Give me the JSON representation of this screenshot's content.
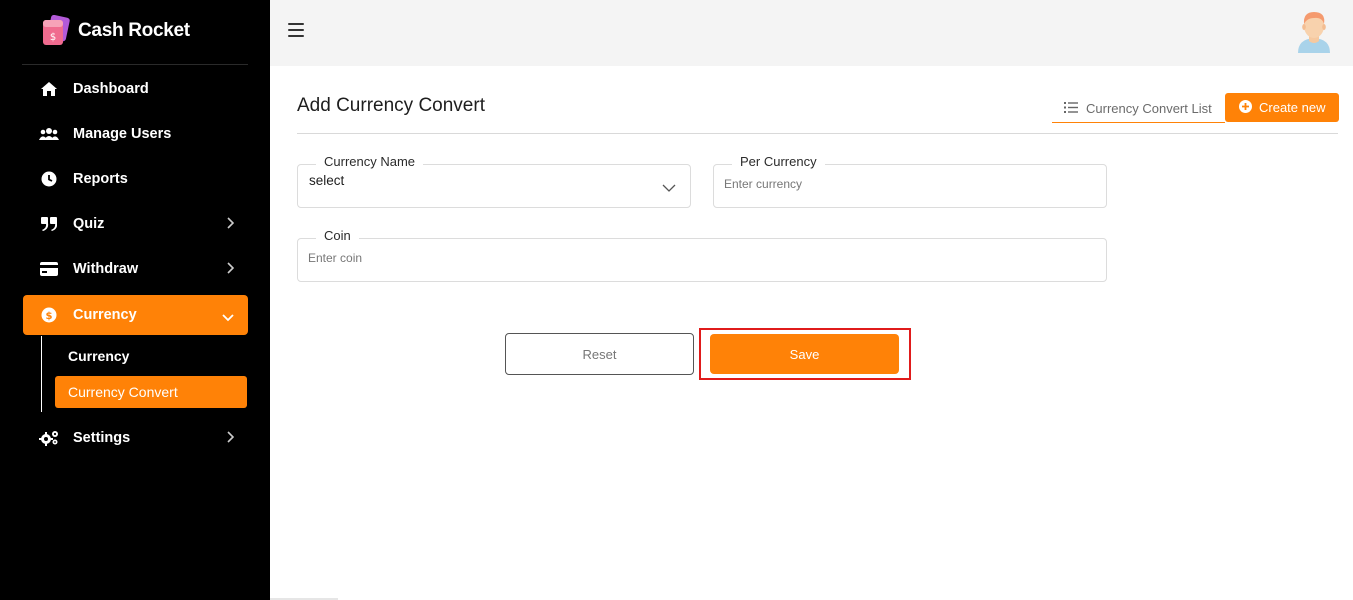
{
  "brand": {
    "name": "Cash Rocket",
    "logo_icon": "wallet-logo-icon"
  },
  "sidebar": {
    "items": [
      {
        "label": "Dashboard",
        "icon": "home-icon"
      },
      {
        "label": "Manage Users",
        "icon": "users-icon"
      },
      {
        "label": "Reports",
        "icon": "clock-icon"
      },
      {
        "label": "Quiz",
        "icon": "quote-icon"
      },
      {
        "label": "Withdraw",
        "icon": "credit-card-icon"
      },
      {
        "label": "Currency",
        "icon": "dollar-circle-icon"
      },
      {
        "label": "Settings",
        "icon": "gears-icon"
      }
    ],
    "currency_submenu": [
      {
        "label": "Currency"
      },
      {
        "label": "Currency Convert"
      }
    ],
    "active_item": "Currency",
    "active_subitem": "Currency Convert",
    "accent_color": "#ff8207",
    "background_color": "#000000"
  },
  "topbar": {
    "menu_icon": "hamburger-icon",
    "avatar_icon": "user-avatar-icon"
  },
  "main": {
    "title": "Add Currency Convert",
    "list_link": "Currency Convert List",
    "create_button": "Create new",
    "form": {
      "currency_name": {
        "label": "Currency Name",
        "value": "select"
      },
      "per_currency": {
        "label": "Per Currency",
        "placeholder": "Enter currency"
      },
      "coin": {
        "label": "Coin",
        "placeholder": "Enter coin"
      }
    },
    "reset_button": "Reset",
    "save_button": "Save",
    "highlight_color": "#e01b1b"
  }
}
